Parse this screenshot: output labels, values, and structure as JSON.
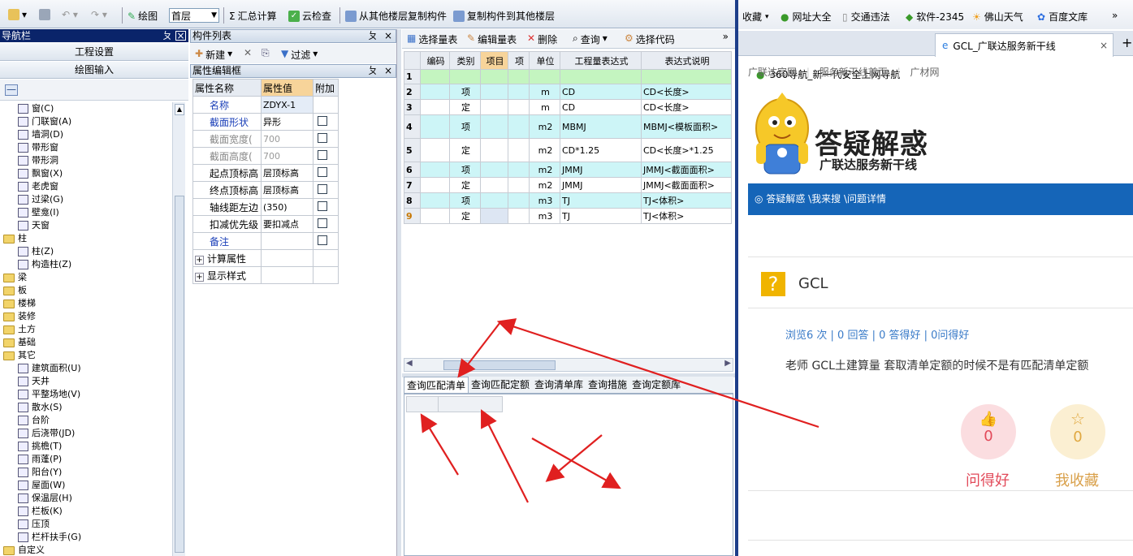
{
  "toolbar": {
    "floor_label": "绘图",
    "floor_value": "首层",
    "sum_label": "汇总计算",
    "cloud_check": "云检查",
    "copy_from": "从其他楼层复制构件",
    "copy_to": "复制构件到其他楼层"
  },
  "nav": {
    "title": "导航栏",
    "pin": "ㄆ",
    "close": "×",
    "project_settings": "工程设置",
    "drawing_input": "绘图输入",
    "collapse": "—"
  },
  "tree": [
    {
      "label": "窗(C)",
      "type": "item",
      "indent": 1
    },
    {
      "label": "门联窗(A)",
      "type": "item",
      "indent": 1
    },
    {
      "label": "墙洞(D)",
      "type": "item",
      "indent": 1
    },
    {
      "label": "带形窗",
      "type": "item",
      "indent": 1
    },
    {
      "label": "带形洞",
      "type": "item",
      "indent": 1
    },
    {
      "label": "飘窗(X)",
      "type": "item",
      "indent": 1
    },
    {
      "label": "老虎窗",
      "type": "item",
      "indent": 1
    },
    {
      "label": "过梁(G)",
      "type": "item",
      "indent": 1
    },
    {
      "label": "壁龛(I)",
      "type": "item",
      "indent": 1
    },
    {
      "label": "天窗",
      "type": "item",
      "indent": 1
    },
    {
      "label": "柱",
      "type": "folder",
      "indent": 0
    },
    {
      "label": "柱(Z)",
      "type": "item",
      "indent": 1
    },
    {
      "label": "构造柱(Z)",
      "type": "item",
      "indent": 1
    },
    {
      "label": "梁",
      "type": "folder",
      "indent": 0
    },
    {
      "label": "板",
      "type": "folder",
      "indent": 0
    },
    {
      "label": "楼梯",
      "type": "folder",
      "indent": 0
    },
    {
      "label": "装修",
      "type": "folder",
      "indent": 0
    },
    {
      "label": "土方",
      "type": "folder",
      "indent": 0
    },
    {
      "label": "基础",
      "type": "folder",
      "indent": 0
    },
    {
      "label": "其它",
      "type": "folder",
      "indent": 0
    },
    {
      "label": "建筑面积(U)",
      "type": "item",
      "indent": 1
    },
    {
      "label": "天井",
      "type": "item",
      "indent": 1
    },
    {
      "label": "平整场地(V)",
      "type": "item",
      "indent": 1
    },
    {
      "label": "散水(S)",
      "type": "item",
      "indent": 1
    },
    {
      "label": "台阶",
      "type": "item",
      "indent": 1
    },
    {
      "label": "后浇带(JD)",
      "type": "item",
      "indent": 1
    },
    {
      "label": "挑檐(T)",
      "type": "item",
      "indent": 1
    },
    {
      "label": "雨蓬(P)",
      "type": "item",
      "indent": 1
    },
    {
      "label": "阳台(Y)",
      "type": "item",
      "indent": 1
    },
    {
      "label": "屋面(W)",
      "type": "item",
      "indent": 1
    },
    {
      "label": "保温层(H)",
      "type": "item",
      "indent": 1
    },
    {
      "label": "栏板(K)",
      "type": "item",
      "indent": 1
    },
    {
      "label": "压顶",
      "type": "item",
      "indent": 1
    },
    {
      "label": "栏杆扶手(G)",
      "type": "item",
      "indent": 1
    },
    {
      "label": "自定义",
      "type": "folder",
      "indent": 0
    }
  ],
  "component_list": {
    "title": "构件列表",
    "new": "新建",
    "filter": "过滤"
  },
  "prop_editor": {
    "title": "属性编辑框",
    "headers": [
      "属性名称",
      "属性值",
      "附加"
    ],
    "rows": [
      {
        "name": "名称",
        "value": "ZDYX-1",
        "blue": true,
        "check": false
      },
      {
        "name": "截面形状",
        "value": "异形",
        "blue": true,
        "check": true
      },
      {
        "name": "截面宽度(",
        "value": "700",
        "gray": true,
        "check": true
      },
      {
        "name": "截面高度(",
        "value": "700",
        "gray": true,
        "check": true
      },
      {
        "name": "起点顶标高",
        "value": "层顶标高",
        "check": true
      },
      {
        "name": "终点顶标高",
        "value": "层顶标高",
        "check": true
      },
      {
        "name": "轴线距左边",
        "value": "(350)",
        "check": true
      },
      {
        "name": "扣减优先级",
        "value": "要扣减点",
        "check": true
      },
      {
        "name": "备注",
        "value": "",
        "blue": true,
        "check": true
      },
      {
        "name": "计算属性",
        "value": "",
        "expand": "+",
        "check": false
      },
      {
        "name": "显示样式",
        "value": "",
        "expand": "+",
        "check": false
      }
    ]
  },
  "quantity_toolbar": {
    "select": "选择量表",
    "edit": "编辑量表",
    "delete": "删除",
    "query": "查询",
    "select_code": "选择代码",
    "more": "»"
  },
  "grid": {
    "headers": [
      "编码",
      "类别",
      "项目",
      "项",
      "单位",
      "工程量表达式",
      "表达式说明"
    ],
    "rows": [
      {
        "n": "1",
        "cat": "",
        "unit": "",
        "expr": "",
        "desc": ""
      },
      {
        "n": "2",
        "cat": "项",
        "unit": "m",
        "expr": "CD",
        "desc": "CD<长度>"
      },
      {
        "n": "3",
        "cat": "定",
        "unit": "m",
        "expr": "CD",
        "desc": "CD<长度>"
      },
      {
        "n": "4",
        "cat": "项",
        "unit": "m2",
        "expr": "MBMJ",
        "desc": "MBMJ<模板面积>"
      },
      {
        "n": "5",
        "cat": "定",
        "unit": "m2",
        "expr": "CD*1.25",
        "desc": "CD<长度>*1.25"
      },
      {
        "n": "6",
        "cat": "项",
        "unit": "m2",
        "expr": "JMMJ",
        "desc": "JMMJ<截面面积>"
      },
      {
        "n": "7",
        "cat": "定",
        "unit": "m2",
        "expr": "JMMJ",
        "desc": "JMMJ<截面面积>"
      },
      {
        "n": "8",
        "cat": "项",
        "unit": "m3",
        "expr": "TJ",
        "desc": "TJ<体积>"
      },
      {
        "n": "9",
        "cat": "定",
        "unit": "m3",
        "expr": "TJ",
        "desc": "TJ<体积>"
      }
    ]
  },
  "bottom_tabs": [
    "查询匹配清单",
    "查询匹配定额",
    "查询清单库",
    "查询措施",
    "查询定额库"
  ],
  "browser": {
    "favorites": [
      "收藏",
      "网址大全",
      "交通违法",
      "软件-2345",
      "佛山天气",
      "百度文库"
    ],
    "more": "»",
    "tabs": [
      {
        "label": "360导航_新一代安全上网导航"
      },
      {
        "label": "GCL_广联达服务新干线"
      }
    ],
    "tab_close": "×",
    "new_tab": "+",
    "site_links": [
      "广联达官网",
      "服务新干线首页",
      "广材网"
    ],
    "banner_title": "答疑解惑",
    "banner_subtitle": "广联达服务新干线",
    "breadcrumb": "答疑解惑 \\我来搜 \\问题详情",
    "question_mark": "?",
    "question_title": "GCL",
    "stats": "浏览6 次 | 0 回答 | 0 答得好 | 0问得好",
    "question_text": "老师 GCL土建算量 套取清单定额的时候不是有匹配清单定额",
    "like_count": "0",
    "like_label": "问得好",
    "fav_count": "0",
    "fav_label": "我收藏"
  }
}
